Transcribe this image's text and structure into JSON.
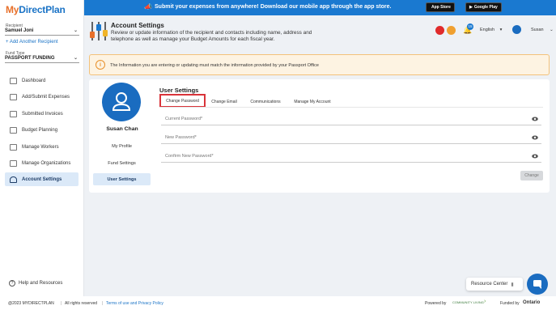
{
  "logo": {
    "part1": "My",
    "part2": "DirectPlan"
  },
  "sidebar": {
    "recipient_label": "Recipient",
    "recipient_value": "Samuel Joni",
    "add_recipient": "+ Add Another Recipient",
    "fund_type_label": "Fund Type",
    "fund_type_value": "PASSPORT FUNDING",
    "items": [
      {
        "label": "Dashboard",
        "icon": "dashboard-icon"
      },
      {
        "label": "Add/Submit Expenses",
        "icon": "receipt-icon"
      },
      {
        "label": "Submitted Invoices",
        "icon": "invoice-icon"
      },
      {
        "label": "Budget Planning",
        "icon": "table-icon"
      },
      {
        "label": "Manage Workers",
        "icon": "workers-icon"
      },
      {
        "label": "Manage Organizations",
        "icon": "building-icon"
      },
      {
        "label": "Account Settings",
        "icon": "user-icon"
      }
    ],
    "help": "Help and Resources"
  },
  "banner": {
    "message": "Submit your expenses from anywhere! Download our mobile app through the app store.",
    "app_store": "App Store",
    "google_play": "Google Play"
  },
  "header": {
    "title": "Account Settings",
    "subtitle": "Review or update information of the recipient and contacts including name, address and telephone as well as manage your Budget Amounts for each fiscal year.",
    "notification_count": "15",
    "language": "English",
    "user": "Susan"
  },
  "notice": {
    "text": "The Information you are entering or updating must match the information provided by your Passport Office"
  },
  "profile": {
    "name": "Susan Chan",
    "links": [
      "My Profile",
      "Fund Settings",
      "User Settings"
    ]
  },
  "user_settings": {
    "title": "User Settings",
    "tabs": [
      "Change Password",
      "Change Email",
      "Communications",
      "Manage My Account"
    ],
    "fields": {
      "current": "Current Password*",
      "new": "New Password*",
      "confirm": "Confirm New Password*"
    },
    "button": "Change"
  },
  "footer": {
    "copyright": "@2023 MYDIRECTPLAN",
    "rights": "All rights reserved",
    "terms": "Terms of use and Privacy Policy",
    "powered": "Powered by",
    "community": "COMMUNITY LIVING",
    "funded": "Funded by",
    "ontario": "Ontario"
  },
  "resource_center": "Resource Center",
  "colors": {
    "brand_blue": "#1a79d0",
    "brand_orange": "#e8702a",
    "highlight_red": "#d9343a"
  }
}
